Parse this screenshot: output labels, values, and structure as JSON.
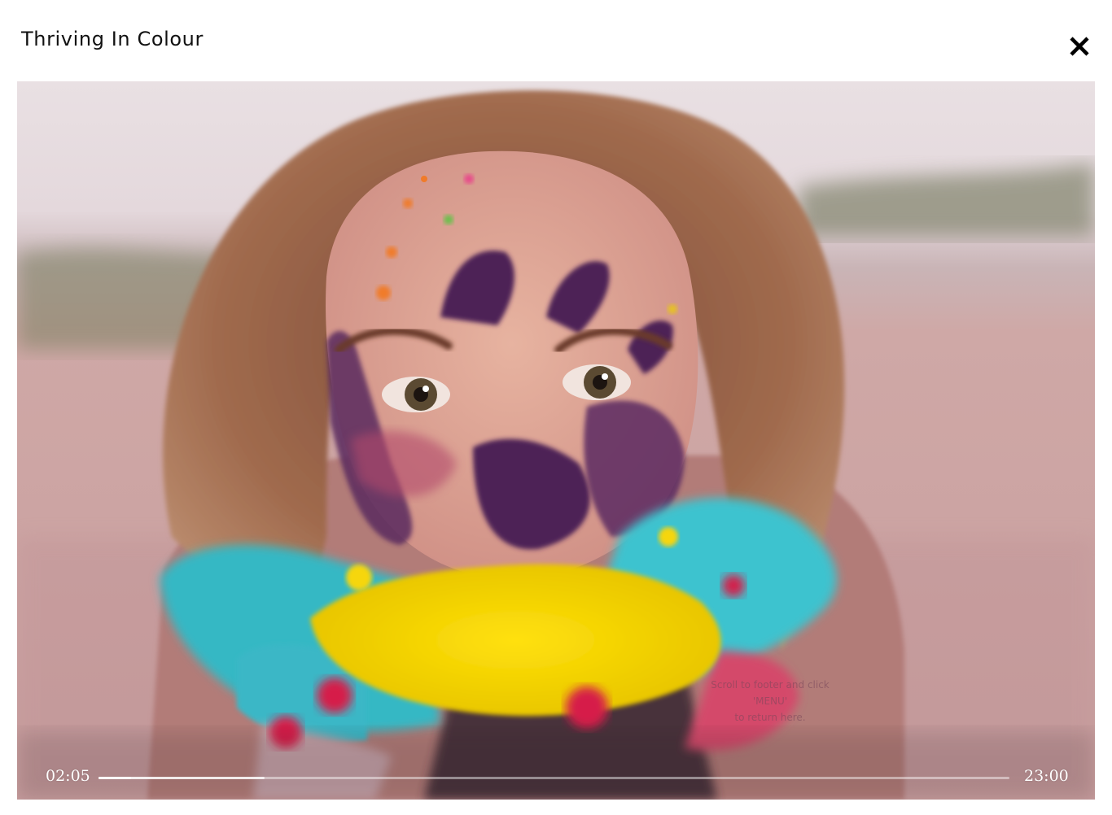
{
  "header": {
    "title": "Thriving In Colour",
    "close_icon": "close-icon"
  },
  "video": {
    "hint_line1": "Scroll to footer and click 'MENU'",
    "hint_line2": "to return here.",
    "current_time": "02:05",
    "total_time": "23:00",
    "progress_played": 0.036,
    "progress_buffered": 0.182
  },
  "colors": {
    "powder_yellow": "#f2d20a",
    "powder_cyan": "#3cc3cf",
    "powder_purple": "#4e2457",
    "powder_red": "#d61e4a"
  }
}
